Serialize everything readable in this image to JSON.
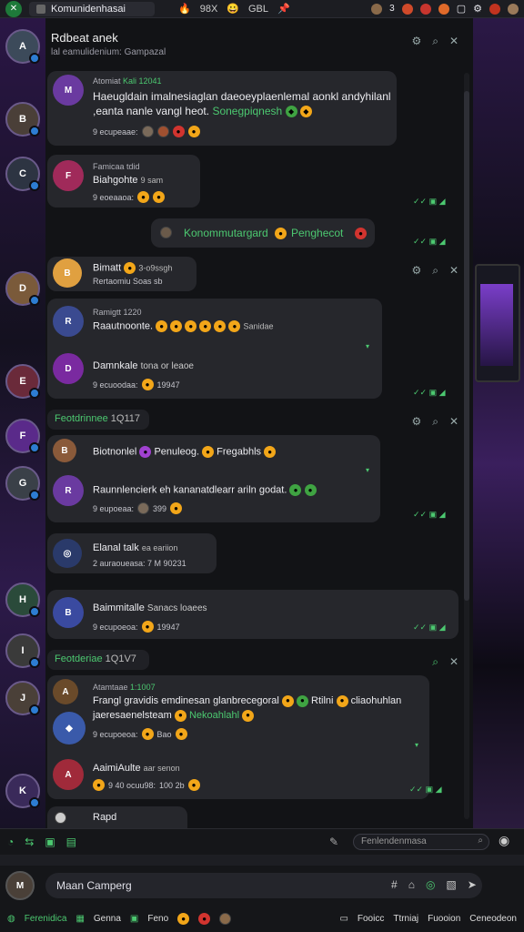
{
  "topbar": {
    "app_title": "Komunidenhasai",
    "status1": "98X",
    "status2": "GBL"
  },
  "header": {
    "title": "Rdbeat anek",
    "subtitle": "lal eamulidenium: Gampazal"
  },
  "messages": [
    {
      "name": "Atomiat",
      "badge": "Kali 12041",
      "text": "Haeugldain imalnesiaglan daeoeyplaenlemal aonkl andyhilanl ,eanta nanle vangl heot.",
      "highlight": "Sonegpiqnesh",
      "meta": "9 ecupeaae:"
    },
    {
      "name": "Famicaa tdid",
      "text": "Biahgohte",
      "meta": "9 eoeaaoa:",
      "sub": "9 sam"
    },
    {
      "name": "",
      "text": "Konommutargard",
      "tail": "Penghecot",
      "meta": ""
    },
    {
      "name": "",
      "text": "Bimatt",
      "sub": "3-o9ssgh",
      "meta": "Rertaomiu Soas sb"
    },
    {
      "name": "Ramigtt",
      "badge": "1220",
      "text": "Raautnoonte.",
      "tail": "Sanidae",
      "meta": ""
    },
    {
      "name": "",
      "text": "Damnkale",
      "sub": "tona or leaoe",
      "meta": "9 ecuoodaa:",
      "time": "19947"
    },
    {
      "name": "",
      "text": "Biotnonlel",
      "tail2": "Penuleog.",
      "tail3": "Fregabhls",
      "meta": ""
    },
    {
      "name": "",
      "text": "Raunnlencierk eh kananatdlearr ariln godat.",
      "meta": "9 eupoeaa:",
      "time": "399"
    },
    {
      "name": "",
      "text": "Elanal talk",
      "sub": "ea eariion",
      "meta": "2 auraoueasa: 7 M 90231"
    },
    {
      "name": "",
      "text": "Baimmitalle",
      "sub": "Sanacs loaees",
      "meta": "9 ecupoeoa:",
      "time": "19947"
    },
    {
      "name": "Atamtaae",
      "badge": "1:1007",
      "text": "Frangl gravidis emdinesan glanbrecegoral",
      "t2": "Rtilni",
      "t3": "cliaohuhlan jaeresaenelsteam",
      "highlight": "Nekoahlahl",
      "meta": "9 ecupoeoa:",
      "time": "Bao"
    },
    {
      "name": "",
      "text": "AaimiAulte",
      "sub": "aar senon",
      "meta": "9 40 ocuu98:",
      "time": "100 2b"
    },
    {
      "name": "",
      "text": "Rapd",
      "meta": ""
    }
  ],
  "sections": [
    {
      "label": "Feotdrinnee",
      "num": "1Q117"
    },
    {
      "label": "Feotderiae",
      "num": "1Q1V7"
    }
  ],
  "composer": {
    "search_placeholder": "Fenlendenmasa",
    "message_value": "Maan Camperg",
    "bottom": [
      "Ferenidica",
      "Genna",
      "Feno",
      "Fooicc",
      "Ttrniaj",
      "Fuooion",
      "Ceneodeon"
    ]
  },
  "colors": {
    "accent": "#4cc870",
    "bubble": "#26272c",
    "bg": "#121316"
  }
}
